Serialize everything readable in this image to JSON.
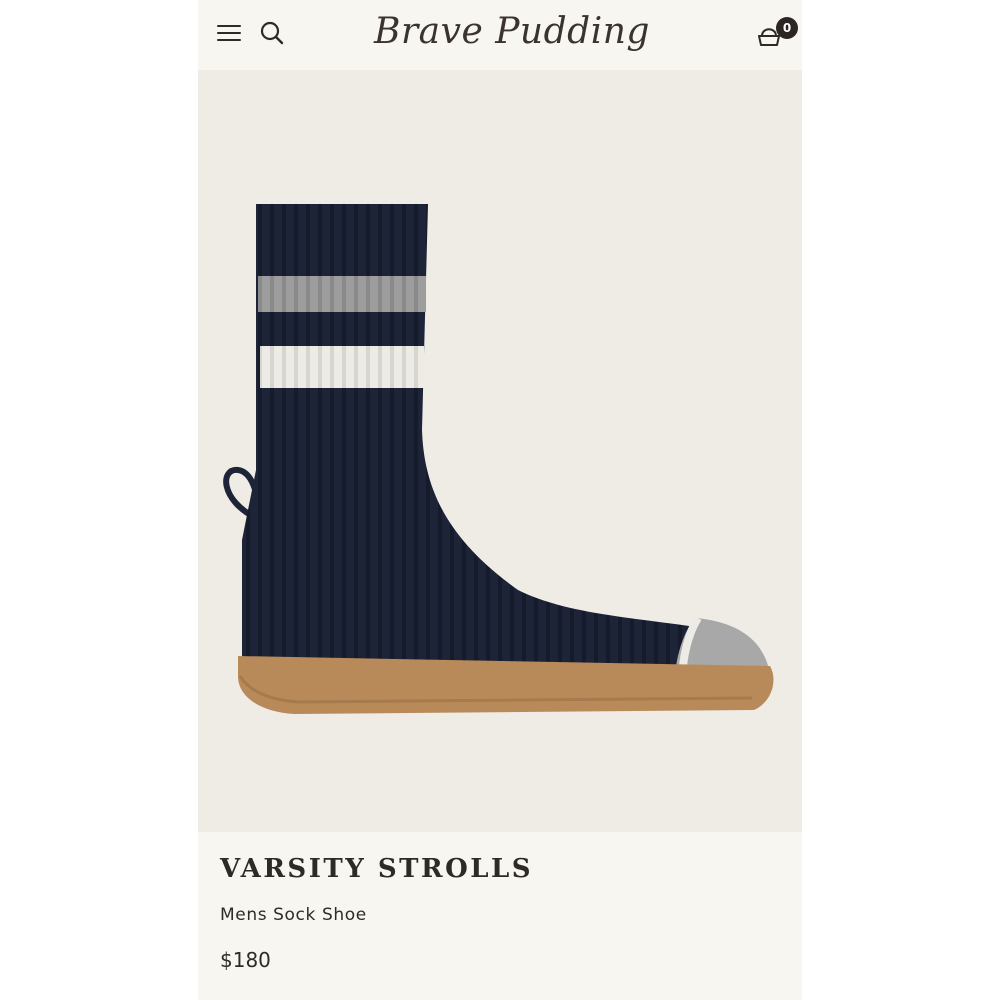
{
  "header": {
    "logo_text": "Brave Pudding",
    "cart_count": "0",
    "icons": {
      "menu": "hamburger-menu-icon",
      "search": "search-icon",
      "cart": "shopping-bag-icon"
    }
  },
  "product": {
    "name": "VARSITY STROLLS",
    "type": "Mens Sock Shoe",
    "price": "$180",
    "image": "product-photo-sock-shoe"
  },
  "colors": {
    "page_background": "#f8f6f1",
    "image_background": "#efece5",
    "text": "#2e2a28",
    "sock_navy": "#1e2438",
    "stripe_grey": "#9a9a9a",
    "stripe_white": "#ecebe6",
    "sole_tan": "#b88a5a"
  }
}
